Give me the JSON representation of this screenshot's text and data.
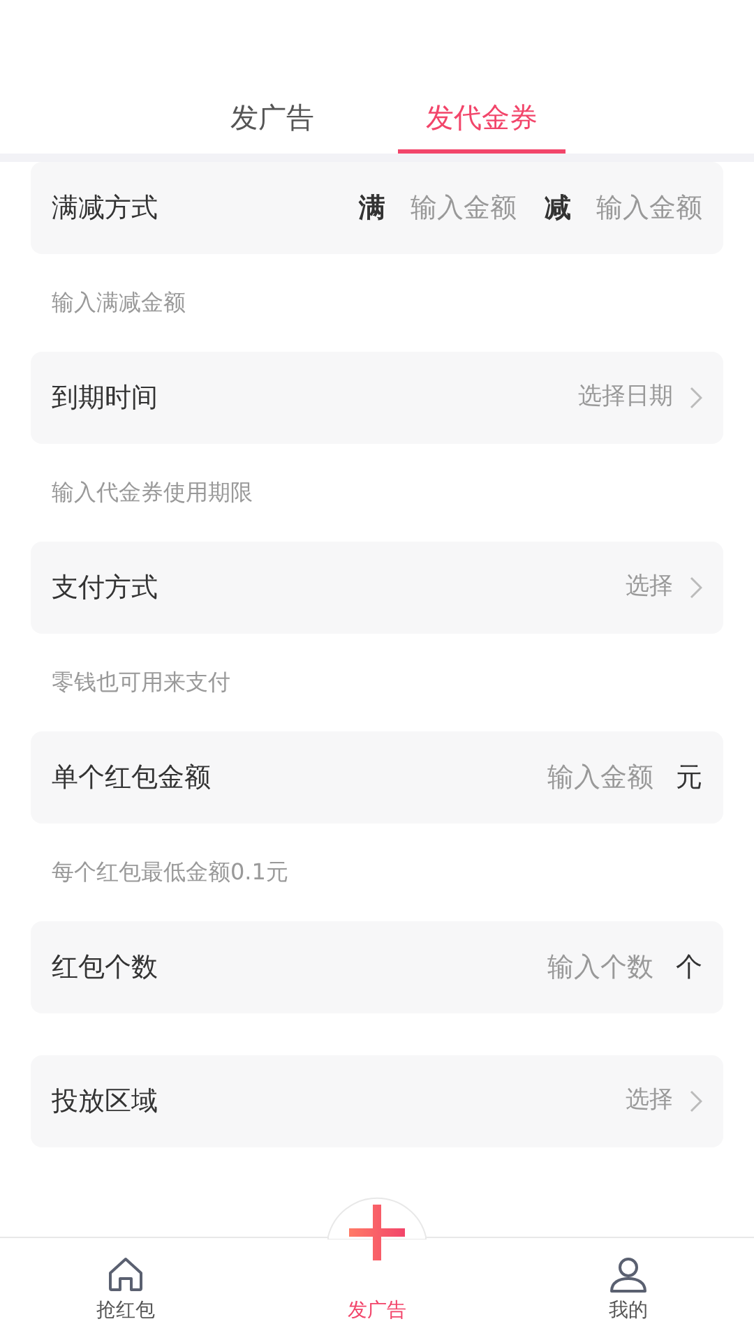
{
  "tabs": [
    {
      "label": "发广告",
      "selected": false
    },
    {
      "label": "发代金券",
      "selected": true
    }
  ],
  "form": [
    {
      "kind": "range",
      "label": "满减方式",
      "full_label": "满",
      "full_placeholder": "输入金额",
      "minus_label": "减",
      "minus_placeholder": "输入金额",
      "hint": "输入满减金额"
    },
    {
      "kind": "picker",
      "label": "到期时间",
      "value": "选择日期",
      "hint": "输入代金券使用期限"
    },
    {
      "kind": "picker",
      "label": "支付方式",
      "value": "选择",
      "hint": "零钱也可用来支付"
    },
    {
      "kind": "input_unit",
      "label": "单个红包金额",
      "placeholder": "输入金额",
      "unit": "元",
      "hint": "每个红包最低金额0.1元"
    },
    {
      "kind": "input_unit",
      "label": "红包个数",
      "placeholder": "输入个数",
      "unit": "个"
    },
    {
      "kind": "picker",
      "label": "投放区域",
      "value": "选择"
    }
  ],
  "bottom_nav": [
    {
      "kind": "home",
      "label": "抢红包",
      "selected": false
    },
    {
      "kind": "plus",
      "label": "发广告",
      "selected": true
    },
    {
      "kind": "user",
      "label": "我的",
      "selected": false
    }
  ]
}
